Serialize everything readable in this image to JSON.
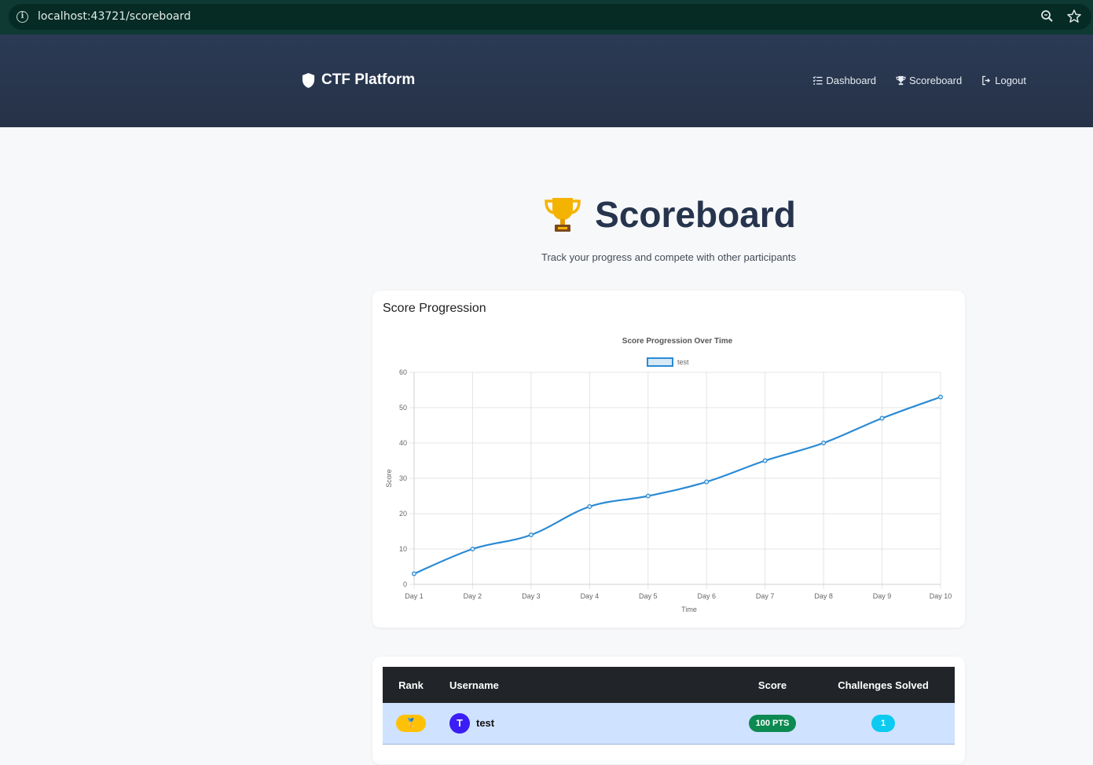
{
  "browser": {
    "url": "localhost:43721/scoreboard"
  },
  "nav": {
    "brand": "CTF Platform",
    "links": [
      {
        "label": "Dashboard",
        "icon": "tasks-icon"
      },
      {
        "label": "Scoreboard",
        "icon": "trophy-icon"
      },
      {
        "label": "Logout",
        "icon": "logout-icon"
      }
    ]
  },
  "header": {
    "title": "Scoreboard",
    "subtitle": "Track your progress and compete with other participants"
  },
  "chart_card": {
    "title": "Score Progression"
  },
  "chart_data": {
    "type": "line",
    "title": "Score Progression Over Time",
    "xlabel": "Time",
    "ylabel": "Score",
    "categories": [
      "Day 1",
      "Day 2",
      "Day 3",
      "Day 4",
      "Day 5",
      "Day 6",
      "Day 7",
      "Day 8",
      "Day 9",
      "Day 10"
    ],
    "series": [
      {
        "name": "test",
        "values": [
          3,
          10,
          14,
          22,
          25,
          29,
          35,
          40,
          47,
          53
        ],
        "color": "#2a8ad4"
      }
    ],
    "ylim": [
      0,
      60
    ],
    "yticks": [
      0,
      10,
      20,
      30,
      40,
      50,
      60
    ],
    "grid": true,
    "legend": "top-center"
  },
  "table": {
    "headers": {
      "rank": "Rank",
      "username": "Username",
      "score": "Score",
      "solved": "Challenges Solved"
    },
    "rows": [
      {
        "rank_icon": "🥇",
        "avatar_letter": "T",
        "username": "test",
        "score": "100 PTS",
        "solved": "1"
      }
    ]
  },
  "colors": {
    "navbar": "#2b3a55",
    "accent_line": "#2a8ad4",
    "row_highlight": "#cfe2ff",
    "score_badge": "#0c8a52",
    "solved_badge": "#0dcaf0",
    "rank_badge": "#ffc107"
  }
}
